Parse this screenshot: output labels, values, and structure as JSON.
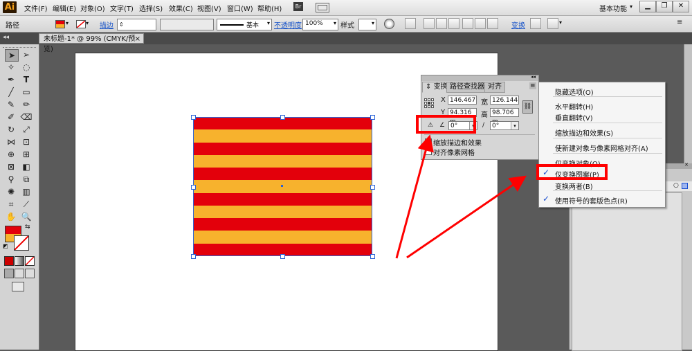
{
  "app": {
    "logo": "Ai"
  },
  "menubar": {
    "items": [
      "文件(F)",
      "编辑(E)",
      "对象(O)",
      "文字(T)",
      "选择(S)",
      "效果(C)",
      "视图(V)",
      "窗口(W)",
      "帮助(H)"
    ],
    "bridge": "Br",
    "workspace": "基本功能"
  },
  "control_bar": {
    "selection_type": "路径",
    "stroke_label": "描边",
    "brush_label": "基本",
    "opacity_label": "不透明度",
    "opacity_value": "100%",
    "style_label": "样式",
    "transform_label": "变换"
  },
  "doc_tab": {
    "title": "未标题-1* @ 99% (CMYK/预览)",
    "close": "×"
  },
  "transform_panel": {
    "tabs": [
      "变换",
      "路径查找器",
      "对齐"
    ],
    "x_label": "X",
    "x_value": "146.467",
    "w_label": "宽",
    "w_value": "126.144",
    "y_label": "Y",
    "y_value": "94.316 m",
    "h_label": "高",
    "h_value": "98.706 m",
    "rotate_value": "0°",
    "shear_value": "0°",
    "options": [
      "缩放描边和效果",
      "对齐像素网格"
    ]
  },
  "flyout_menu": {
    "items": [
      {
        "label": "隐藏选项(O)",
        "checked": false
      },
      {
        "label": "水平翻转(H)",
        "checked": false
      },
      {
        "label": "垂直翻转(V)",
        "checked": false
      },
      {
        "label": "缩放描边和效果(S)",
        "checked": false
      },
      {
        "label": "使新建对象与像素网格对齐(A)",
        "checked": false
      },
      {
        "label": "仅变换对象(O)",
        "checked": false
      },
      {
        "label": "仅变换图案(P)",
        "checked": true
      },
      {
        "label": "变换两者(B)",
        "checked": false
      },
      {
        "label": "使用符号的套版色点(R)",
        "checked": true
      }
    ],
    "check_glyph": "✓"
  },
  "colors": {
    "stripe_red": "#e3000b",
    "stripe_yellow": "#f7b22d",
    "annotation_red": "#ff0000",
    "selection_blue": "#2b64d8"
  },
  "pattern": {
    "stripe_count": 11,
    "first_stripe": "red"
  }
}
